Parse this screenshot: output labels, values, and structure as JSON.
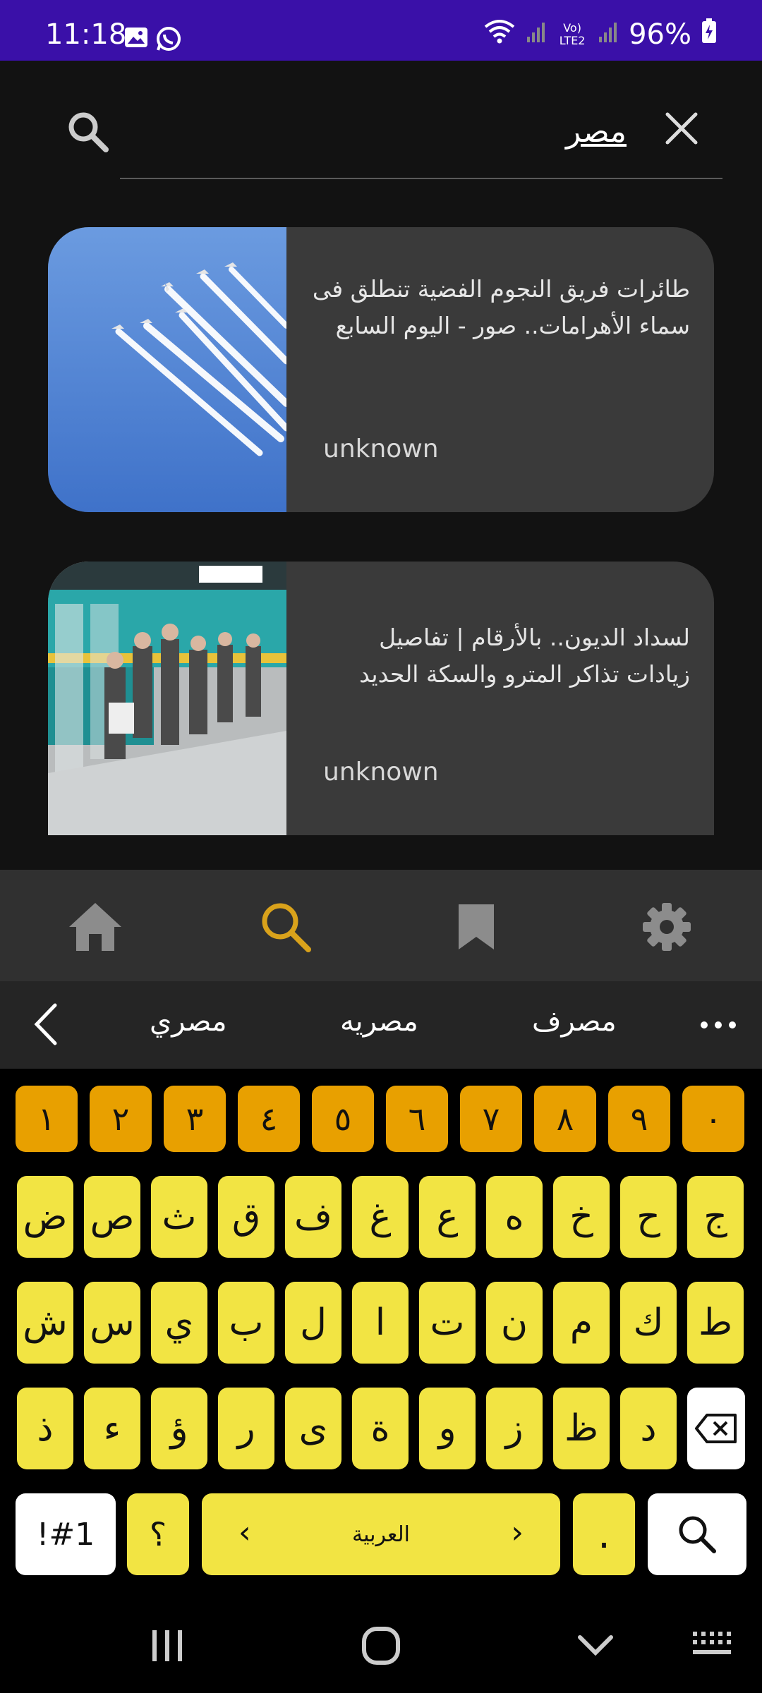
{
  "status": {
    "time": "11:18",
    "battery": "96%",
    "network": "Vo) LTE2"
  },
  "search": {
    "query": "مصر"
  },
  "results": [
    {
      "title": "طائرات فريق النجوم الفضية تنطلق فى سماء الأهرامات.. صور - اليوم السابع",
      "source": "unknown"
    },
    {
      "title": "لسداد الديون.. بالأرقام | تفاصيل زيادات تذاكر المترو والسكة الحديد",
      "source": "unknown"
    }
  ],
  "nav": {
    "items": [
      "home-icon",
      "search-icon",
      "bookmark-icon",
      "settings-icon"
    ],
    "active_color": "#d9a21b",
    "inactive_color": "#8c8c8c"
  },
  "suggestions": [
    "مصري",
    "مصريه",
    "مصرف"
  ],
  "keyboard": {
    "numbers": [
      "١",
      "٢",
      "٣",
      "٤",
      "٥",
      "٦",
      "٧",
      "٨",
      "٩",
      "٠"
    ],
    "row1": [
      "ض",
      "ص",
      "ث",
      "ق",
      "ف",
      "غ",
      "ع",
      "ه",
      "خ",
      "ح",
      "ج"
    ],
    "row2": [
      "ش",
      "س",
      "ي",
      "ب",
      "ل",
      "ا",
      "ت",
      "ن",
      "م",
      "ك",
      "ط"
    ],
    "row3": [
      "ذ",
      "ء",
      "ؤ",
      "ر",
      "ى",
      "ة",
      "و",
      "ز",
      "ظ",
      "د"
    ],
    "symbols_label": "!#1",
    "question": "؟",
    "space_label": "العربية",
    "period": "."
  },
  "colors": {
    "status_bar": "#3a10a8",
    "number_key": "#e8a000",
    "letter_key": "#f2e443"
  }
}
